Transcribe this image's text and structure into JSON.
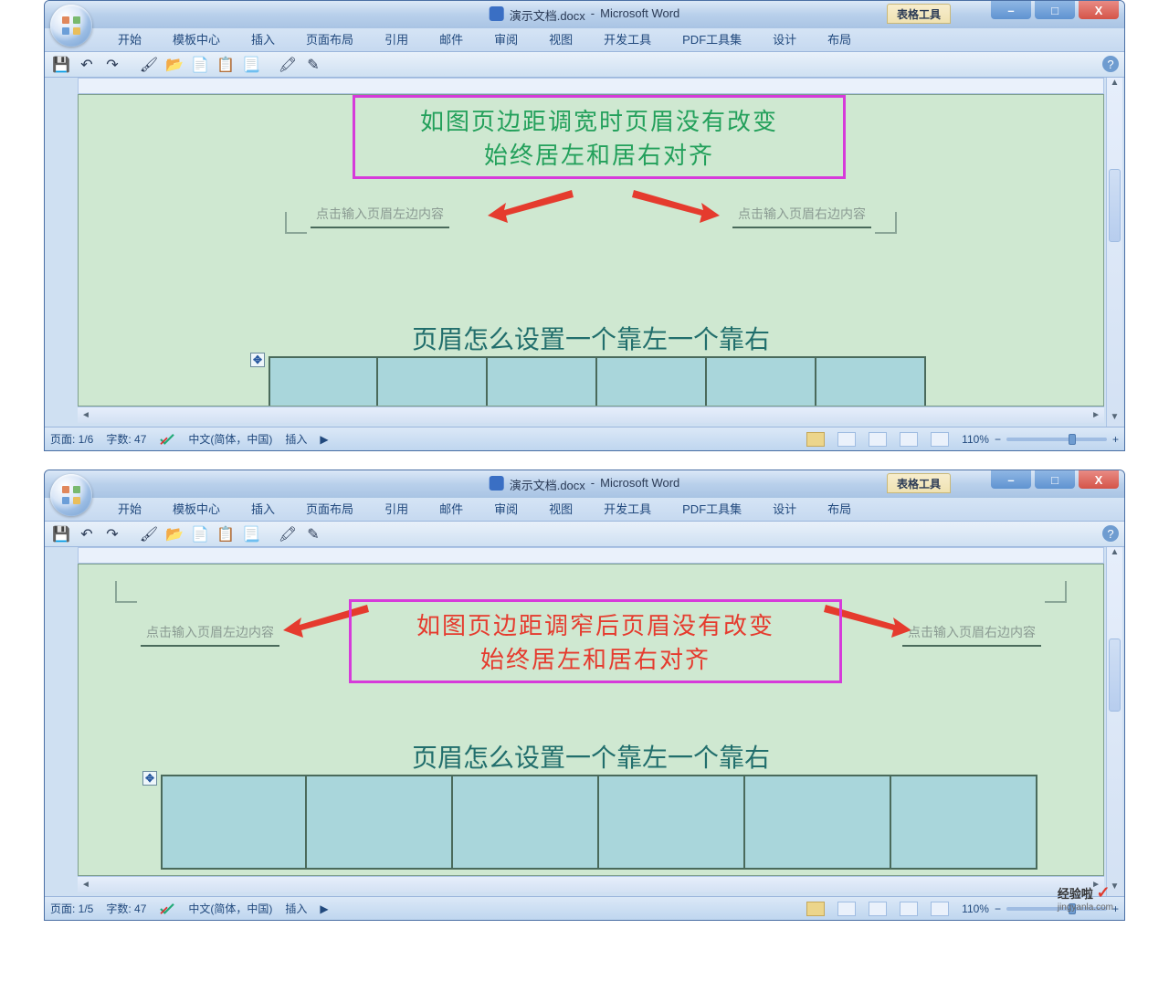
{
  "app": {
    "title_doc": "演示文档.docx",
    "title_app": "Microsoft Word",
    "context_tool": "表格工具"
  },
  "winbuttons": {
    "min": "–",
    "max": "□",
    "close": "X"
  },
  "ribbon": {
    "tabs": [
      "开始",
      "模板中心",
      "插入",
      "页面布局",
      "引用",
      "邮件",
      "审阅",
      "视图",
      "开发工具",
      "PDF工具集",
      "设计",
      "布局"
    ]
  },
  "qat": {
    "icons": [
      "save-icon",
      "undo-icon",
      "redo-icon",
      "sep",
      "format-painter-icon",
      "open-icon",
      "new-icon",
      "copy-icon",
      "paste-icon",
      "sep",
      "brush-icon",
      "pen-icon"
    ]
  },
  "top_panel": {
    "callout_line1": "如图页边距调宽时页眉没有改变",
    "callout_line2": "始终居左和居右对齐",
    "header_left_placeholder": "点击输入页眉左边内容",
    "header_right_placeholder": "点击输入页眉右边内容",
    "doc_heading": "页眉怎么设置一个靠左一个靠右",
    "status": {
      "page": "页面: 1/6",
      "words": "字数: 47",
      "lang": "中文(简体，中国)",
      "mode": "插入",
      "zoom": "110%"
    }
  },
  "bottom_panel": {
    "callout_line1": "如图页边距调窄后页眉没有改变",
    "callout_line2": "始终居左和居右对齐",
    "header_left_placeholder": "点击输入页眉左边内容",
    "header_right_placeholder": "点击输入页眉右边内容",
    "doc_heading": "页眉怎么设置一个靠左一个靠右",
    "status": {
      "page": "页面: 1/5",
      "words": "字数: 47",
      "lang": "中文(简体，中国)",
      "mode": "插入",
      "zoom": "110%"
    }
  },
  "watermark": {
    "brand": "经验啦",
    "url": "jingyanla.com"
  },
  "help": "?"
}
